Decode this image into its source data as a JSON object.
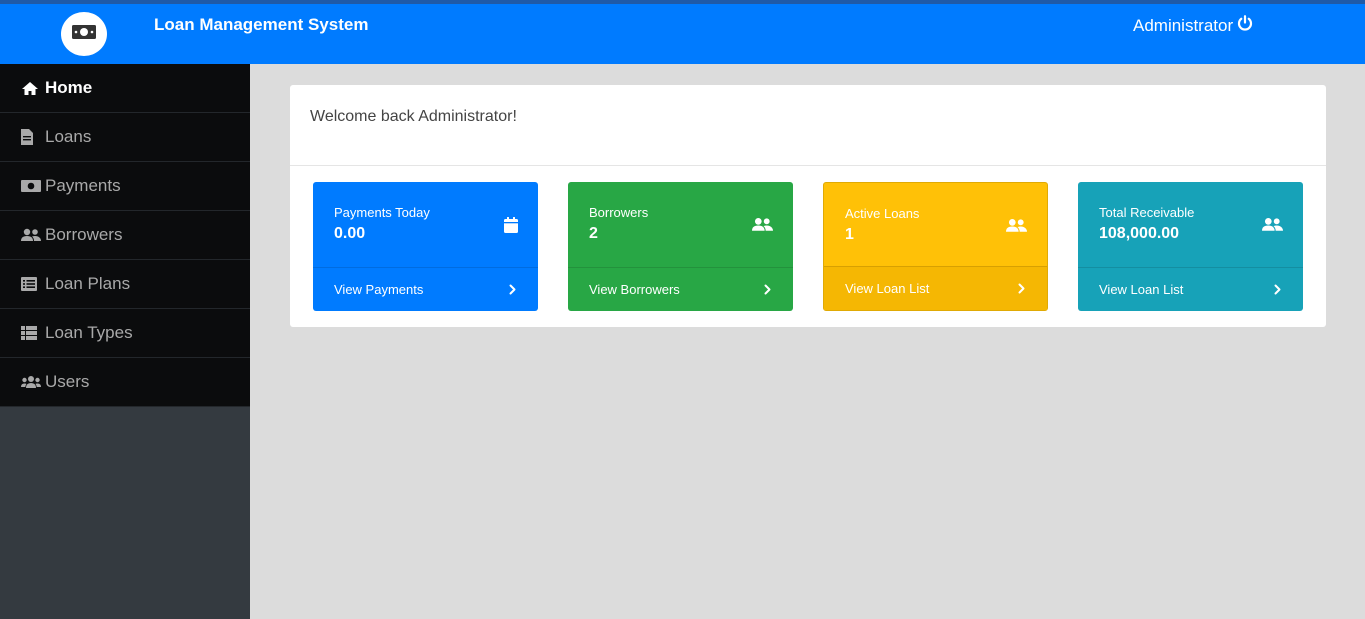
{
  "header": {
    "logo_icon": "money-bill-icon",
    "title": "Loan Management System",
    "user_label": "Administrator",
    "user_icon": "power-icon"
  },
  "sidebar": {
    "items": [
      {
        "label": "Home",
        "icon": "home-icon",
        "active": true
      },
      {
        "label": "Loans",
        "icon": "file-invoice-icon"
      },
      {
        "label": "Payments",
        "icon": "money-bill-icon"
      },
      {
        "label": "Borrowers",
        "icon": "user-friends-icon"
      },
      {
        "label": "Loan Plans",
        "icon": "list-alt-icon"
      },
      {
        "label": "Loan Types",
        "icon": "th-list-icon"
      },
      {
        "label": "Users",
        "icon": "users-icon"
      }
    ]
  },
  "main": {
    "welcome": "Welcome back Administrator!",
    "cards": [
      {
        "label": "Payments Today",
        "value": "0.00",
        "link": "View Payments",
        "icon": "calendar-icon",
        "color": "#007bff"
      },
      {
        "label": "Borrowers",
        "value": "2",
        "link": "View Borrowers",
        "icon": "user-friends-icon",
        "color": "#28a745"
      },
      {
        "label": "Active Loans",
        "value": "1",
        "link": "View Loan List",
        "icon": "user-friends-icon",
        "color": "#ffc107"
      },
      {
        "label": "Total Receivable",
        "value": "108,000.00",
        "link": "View Loan List",
        "icon": "user-friends-icon",
        "color": "#17a2b8"
      }
    ]
  }
}
